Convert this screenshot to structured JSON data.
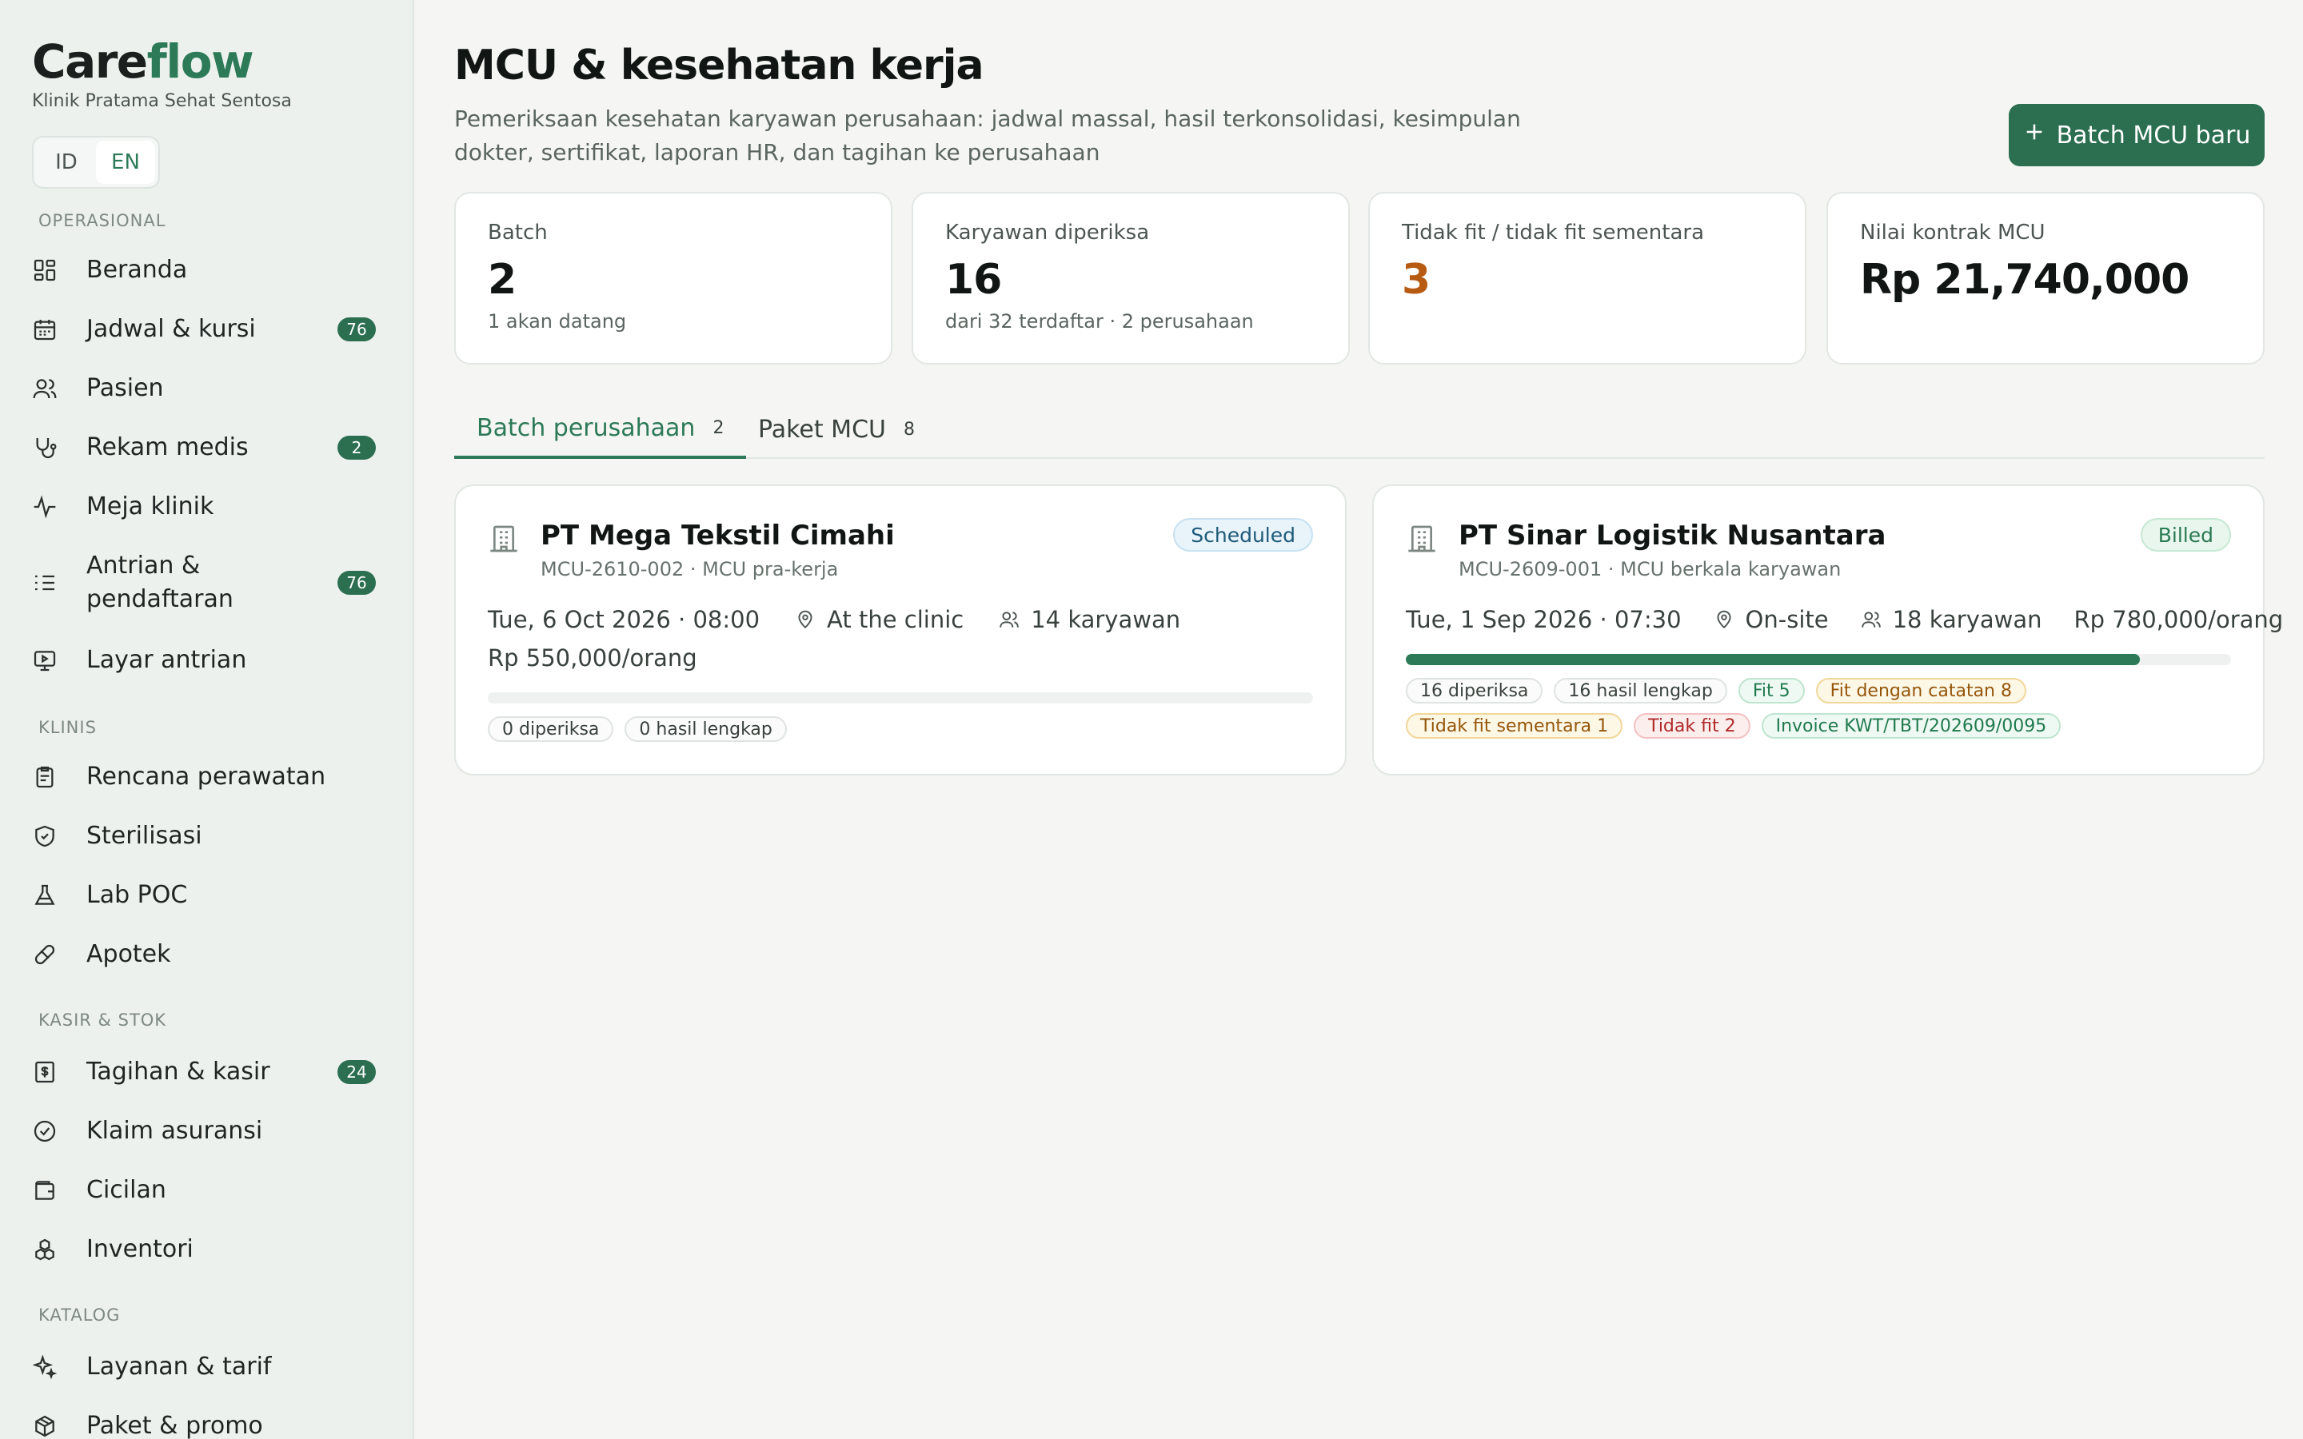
{
  "brand": {
    "name_part1": "Care",
    "name_part2": "flow",
    "subtitle": "Klinik Pratama Sehat Sentosa"
  },
  "lang": {
    "options": [
      "ID",
      "EN"
    ],
    "selected": "EN"
  },
  "sidebar": {
    "sections": [
      "OPERASIONAL",
      "KLINIS",
      "KASIR & STOK",
      "KATALOG"
    ],
    "items": [
      {
        "label": "Beranda",
        "icon": "dashboard-icon",
        "badge": ""
      },
      {
        "label": "Jadwal & kursi",
        "icon": "calendar-icon",
        "badge": "76"
      },
      {
        "label": "Pasien",
        "icon": "users-icon",
        "badge": ""
      },
      {
        "label": "Rekam medis",
        "icon": "stethoscope-icon",
        "badge": "2"
      },
      {
        "label": "Meja klinik",
        "icon": "activity-icon",
        "badge": ""
      },
      {
        "label": "Antrian & pendaftaran",
        "icon": "list-icon",
        "badge": "76"
      },
      {
        "label": "Layar antrian",
        "icon": "monitor-icon",
        "badge": ""
      },
      {
        "label": "Rencana perawatan",
        "icon": "clipboard-icon",
        "badge": ""
      },
      {
        "label": "Sterilisasi",
        "icon": "shield-icon",
        "badge": ""
      },
      {
        "label": "Lab POC",
        "icon": "flask-icon",
        "badge": ""
      },
      {
        "label": "Apotek",
        "icon": "pill-icon",
        "badge": ""
      },
      {
        "label": "Tagihan & kasir",
        "icon": "receipt-icon",
        "badge": "24"
      },
      {
        "label": "Klaim asuransi",
        "icon": "check-circle-icon",
        "badge": ""
      },
      {
        "label": "Cicilan",
        "icon": "wallet-icon",
        "badge": ""
      },
      {
        "label": "Inventori",
        "icon": "boxes-icon",
        "badge": ""
      },
      {
        "label": "Layanan & tarif",
        "icon": "sparkles-icon",
        "badge": ""
      },
      {
        "label": "Paket & promo",
        "icon": "package-icon",
        "badge": ""
      }
    ]
  },
  "header": {
    "title": "MCU & kesehatan kerja",
    "description": "Pemeriksaan kesehatan karyawan perusahaan: jadwal massal, hasil terkonsolidasi, kesimpulan dokter, sertifikat, laporan HR, dan tagihan ke perusahaan",
    "new_batch_label": "Batch MCU baru"
  },
  "stats": [
    {
      "label": "Batch",
      "value": "2",
      "sub": "1 akan datang"
    },
    {
      "label": "Karyawan diperiksa",
      "value": "16",
      "sub": "dari 32 terdaftar · 2 perusahaan"
    },
    {
      "label": "Tidak fit / tidak fit sementara",
      "value": "3",
      "sub": ""
    },
    {
      "label": "Nilai kontrak MCU",
      "value": "Rp 21,740,000",
      "sub": ""
    }
  ],
  "tabs": [
    {
      "label": "Batch perusahaan",
      "count": "2"
    },
    {
      "label": "Paket MCU",
      "count": "8"
    }
  ],
  "batches": [
    {
      "company": "PT Mega Tekstil Cimahi",
      "code": "MCU-2610-002 · MCU pra-kerja",
      "status": "Scheduled",
      "datetime": "Tue, 6 Oct 2026 · 08:00",
      "location": "At the clinic",
      "employees": "14 karyawan",
      "price": "Rp 550,000/orang",
      "progress": 0,
      "chips": [
        "0 diperiksa",
        "0 hasil lengkap"
      ]
    },
    {
      "company": "PT Sinar Logistik Nusantara",
      "code": "MCU-2609-001 · MCU berkala karyawan",
      "status": "Billed",
      "datetime": "Tue, 1 Sep 2026 · 07:30",
      "location": "On-site",
      "employees": "18 karyawan",
      "price": "Rp 780,000/orang",
      "progress": 0.89,
      "chips": [
        "16 diperiksa",
        "16 hasil lengkap",
        "Fit 5",
        "Fit dengan catatan 8",
        "Tidak fit sementara 1",
        "Tidak fit 2",
        "Invoice KWT/TBT/202609/0095"
      ]
    }
  ],
  "colors": {
    "accent": "#2c7a57",
    "primary_button": "#2c6f50",
    "warning_value": "#b75b12",
    "sidebar_bg": "#ecf1ee"
  }
}
